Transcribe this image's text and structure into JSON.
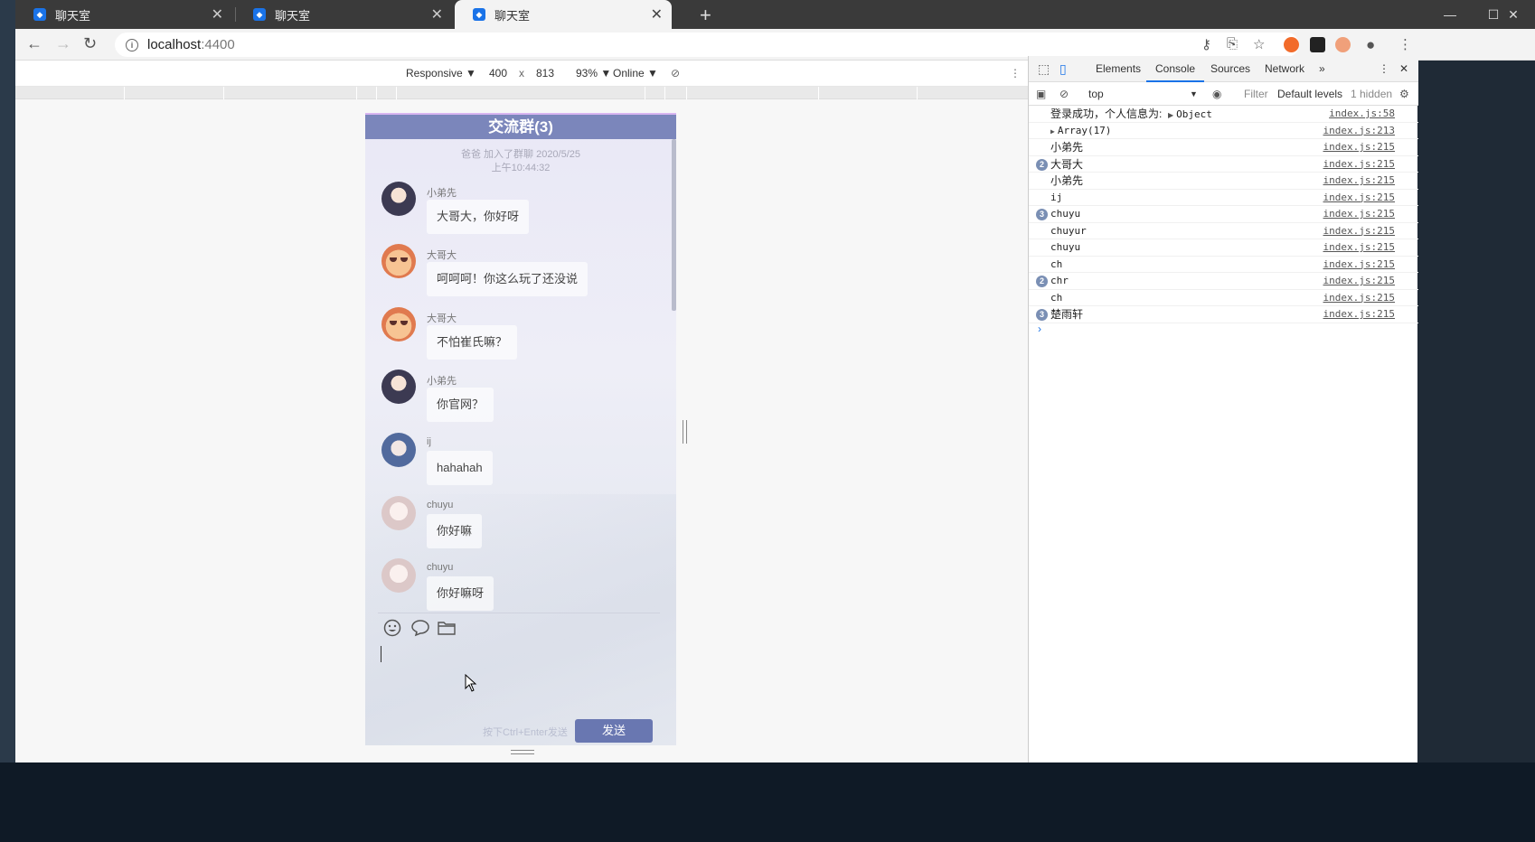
{
  "browser": {
    "tabs": [
      {
        "title": "聊天室"
      },
      {
        "title": "聊天室"
      },
      {
        "title": "聊天室"
      }
    ],
    "url_host": "localhost",
    "url_port": ":4400"
  },
  "device_toolbar": {
    "mode": "Responsive ▼",
    "width": "400",
    "times": "x",
    "height": "813",
    "zoom": "93% ▼",
    "throttle": "Online ▼"
  },
  "chat": {
    "title": "交流群(3)",
    "system_message_line1": "爸爸 加入了群聊 2020/5/25",
    "system_message_line2": "上午10:44:32",
    "messages": [
      {
        "sender": "小弟先",
        "text": "大哥大，你好呀",
        "avatar": "dark"
      },
      {
        "sender": "大哥大",
        "text": "呵呵呵！你这么玩了还没说",
        "avatar": "orange"
      },
      {
        "sender": "大哥大",
        "text": "不怕崔氏嘛？",
        "avatar": "orange"
      },
      {
        "sender": "小弟先",
        "text": "你官网？",
        "avatar": "dark"
      },
      {
        "sender": "ij",
        "text": "hahahah",
        "avatar": "blue"
      },
      {
        "sender": "chuyu",
        "text": "你好嘛",
        "avatar": "pale"
      },
      {
        "sender": "chuyu",
        "text": "你好嘛呀",
        "avatar": "pale"
      }
    ],
    "toolbar_icons": [
      "emoji-icon",
      "chat-bubble-icon",
      "folder-icon"
    ],
    "hint": "按下Ctrl+Enter发送",
    "send_label": "发送"
  },
  "devtools": {
    "tabs": [
      "Elements",
      "Console",
      "Sources",
      "Network"
    ],
    "active_tab": "Console",
    "context": "top",
    "filter_placeholder": "Filter",
    "levels": "Default levels",
    "hidden": "1 hidden",
    "rows": [
      {
        "count": "",
        "text": "登录成功，个人信息为:",
        "extra": "Object",
        "src": "index.js:58"
      },
      {
        "count": "",
        "text": "Array(17)",
        "extra": "",
        "src": "index.js:213"
      },
      {
        "count": "",
        "text": "小弟先",
        "extra": "",
        "src": "index.js:215"
      },
      {
        "count": "2",
        "text": "大哥大",
        "extra": "",
        "src": "index.js:215"
      },
      {
        "count": "",
        "text": "小弟先",
        "extra": "",
        "src": "index.js:215"
      },
      {
        "count": "",
        "text": "ij",
        "extra": "",
        "src": "index.js:215"
      },
      {
        "count": "3",
        "text": "chuyu",
        "extra": "",
        "src": "index.js:215"
      },
      {
        "count": "",
        "text": "chuyur",
        "extra": "",
        "src": "index.js:215"
      },
      {
        "count": "",
        "text": "chuyu",
        "extra": "",
        "src": "index.js:215"
      },
      {
        "count": "",
        "text": "ch",
        "extra": "",
        "src": "index.js:215"
      },
      {
        "count": "2",
        "text": "chr",
        "extra": "",
        "src": "index.js:215"
      },
      {
        "count": "",
        "text": "ch",
        "extra": "",
        "src": "index.js:215"
      },
      {
        "count": "3",
        "text": "楚雨轩",
        "extra": "",
        "src": "index.js:215"
      }
    ]
  }
}
